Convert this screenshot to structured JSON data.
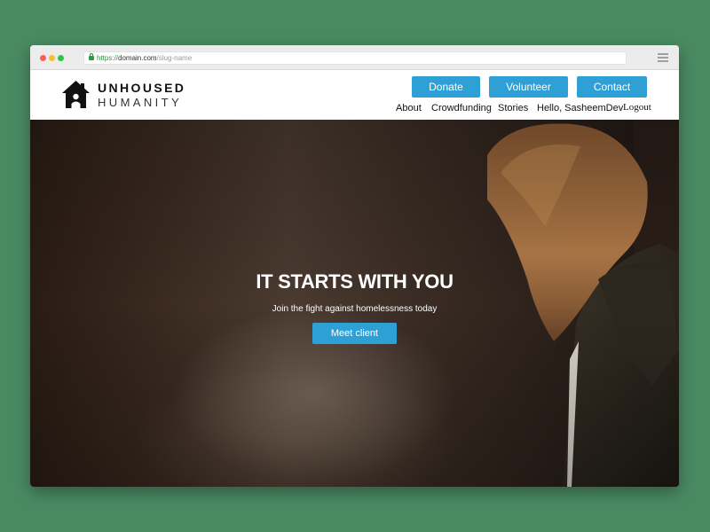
{
  "browser": {
    "url_scheme": "https://",
    "url_host": "domain.com",
    "url_path": "/slug-name"
  },
  "brand": {
    "name_top": "UNHOUSED",
    "name_bottom": "HUMANITY"
  },
  "header": {
    "buttons": {
      "donate": "Donate",
      "volunteer": "Volunteer",
      "contact": "Contact"
    },
    "nav": {
      "about": "About",
      "crowdfunding": "Crowdfunding",
      "stories": "Stories",
      "greeting": "Hello, SasheemDev",
      "logout": "Logout"
    }
  },
  "hero": {
    "title": "IT STARTS WITH YOU",
    "subtitle": "Join the fight against homelessness today",
    "cta": "Meet client"
  },
  "colors": {
    "background": "#4a8a62",
    "accent": "#2fa0d5"
  },
  "icons": {
    "logo": "house-icon",
    "lock": "lock-icon",
    "menu": "hamburger-icon"
  }
}
